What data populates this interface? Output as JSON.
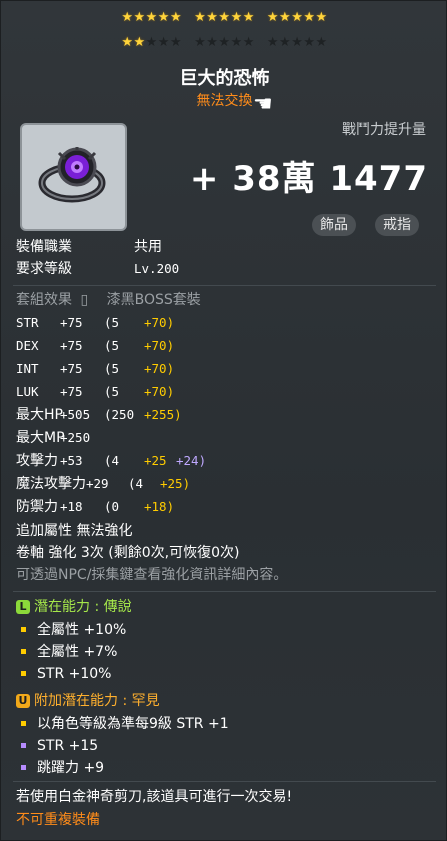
{
  "stars": {
    "row1": [
      1,
      1,
      1,
      1,
      1,
      1,
      1,
      1,
      1,
      1,
      1,
      1,
      1,
      1,
      1
    ],
    "row2": [
      1,
      1,
      0,
      0,
      0,
      0,
      0,
      0,
      0,
      0,
      0,
      0,
      0,
      0,
      0
    ],
    "on_color": "#ffd43b"
  },
  "item": {
    "name": "巨大的恐怖",
    "trade": "無法交換",
    "icon": "purple-eye-ring-icon"
  },
  "combat": {
    "label": "戰鬥力提升量",
    "value": "+ 38萬 1477"
  },
  "tags": [
    "飾品",
    "戒指"
  ],
  "info": [
    {
      "label": "裝備職業",
      "value": "共用"
    },
    {
      "label": "要求等級",
      "value": "Lv.200"
    }
  ],
  "set": {
    "label": "套組效果",
    "value": "漆黑BOSS套裝"
  },
  "stats": [
    {
      "name": "STR",
      "total": "+75",
      "base": "(5",
      "bonus": "+70)",
      "extra": ""
    },
    {
      "name": "DEX",
      "total": "+75",
      "base": "(5",
      "bonus": "+70)",
      "extra": ""
    },
    {
      "name": "INT",
      "total": "+75",
      "base": "(5",
      "bonus": "+70)",
      "extra": ""
    },
    {
      "name": "LUK",
      "total": "+75",
      "base": "(5",
      "bonus": "+70)",
      "extra": ""
    },
    {
      "name": "最大HP",
      "total": "+505",
      "base": "(250",
      "bonus": "+255)",
      "extra": ""
    },
    {
      "name": "最大MP",
      "total": "+250",
      "base": "",
      "bonus": "",
      "extra": ""
    },
    {
      "name": "攻擊力",
      "total": "+53",
      "base": "(4",
      "bonus": "+25",
      "extra": "+24)"
    },
    {
      "name": "魔法攻擊力",
      "total": "+29",
      "base": "(4",
      "bonus": "+25)",
      "extra": ""
    },
    {
      "name": "防禦力",
      "total": "+18",
      "base": "(0",
      "bonus": "+18)",
      "extra": ""
    }
  ],
  "extra_attr": "追加屬性  無法強化",
  "scroll": "卷軸  強化 3次 (剩餘0次,可恢復0次)",
  "hint": "可透過NPC/採集鍵查看強化資訊詳細內容。",
  "potential": {
    "badge": "L",
    "title": "潛在能力 : 傳說",
    "lines": [
      "全屬性 +10%",
      "全屬性 +7%",
      "STR +10%"
    ]
  },
  "additional": {
    "badge": "U",
    "title": "附加潛在能力 : 罕見",
    "lines": [
      {
        "text": "以角色等級為準每9級 STR +1",
        "color": "yellow"
      },
      {
        "text": "STR +15",
        "color": "purple"
      },
      {
        "text": "跳躍力 +9",
        "color": "purple"
      }
    ]
  },
  "notice": "若使用白金神奇剪刀,該道具可進行一次交易!",
  "no_duplicate": "不可重複裝備"
}
